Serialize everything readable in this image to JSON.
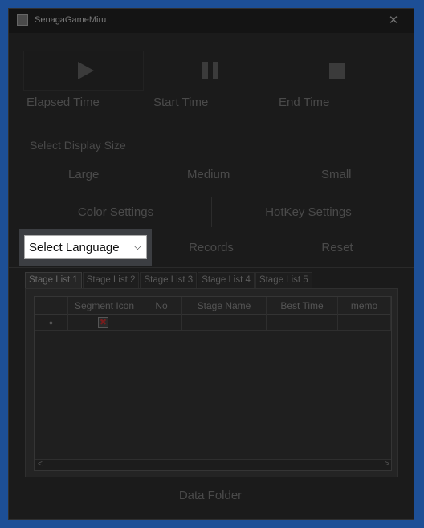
{
  "window": {
    "title": "SenagaGameMiru",
    "minimize_glyph": "—",
    "close_glyph": "✕"
  },
  "controls": {
    "play_icon": "play-icon",
    "pause_icon": "pause-icon",
    "stop_icon": "stop-icon"
  },
  "times": {
    "elapsed": "Elapsed Time",
    "start": "Start Time",
    "end": "End Time"
  },
  "display": {
    "label": "Select Display Size",
    "large": "Large",
    "medium": "Medium",
    "small": "Small"
  },
  "settings": {
    "color": "Color Settings",
    "hotkey": "HotKey Settings"
  },
  "language": {
    "selected": "Select Language",
    "chevron": "⌵"
  },
  "actions": {
    "records": "Records",
    "reset": "Reset",
    "data_folder": "Data Folder"
  },
  "tabs": [
    "Stage List 1",
    "Stage List 2",
    "Stage List 3",
    "Stage List 4",
    "Stage List 5"
  ],
  "active_tab": 0,
  "table": {
    "columns": [
      "",
      "Segment Icon",
      "No",
      "Stage Name",
      "Best Time",
      "memo"
    ],
    "rows": [
      {
        "marker": "●",
        "icon": "✖"
      }
    ]
  },
  "scroll": {
    "left": "<",
    "right": ">"
  },
  "colors": {
    "frame": "#1d4f96",
    "background": "#1b1b1b",
    "selected_panel": "#3c3e42"
  }
}
